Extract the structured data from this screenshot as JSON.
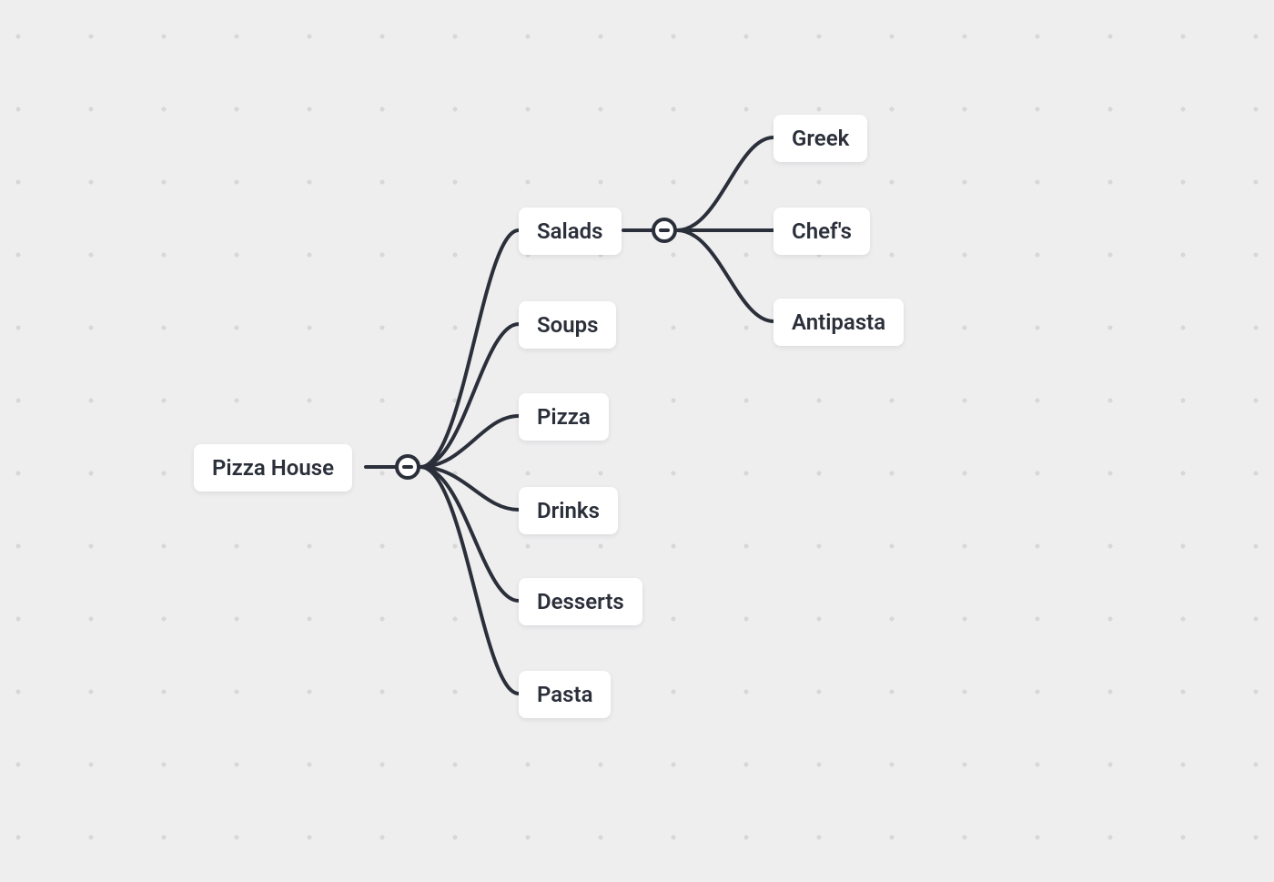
{
  "root": {
    "label": "Pizza House",
    "children": [
      {
        "label": "Salads",
        "expanded": true,
        "children": [
          {
            "label": "Greek"
          },
          {
            "label": "Chef's"
          },
          {
            "label": "Antipasta"
          }
        ]
      },
      {
        "label": "Soups"
      },
      {
        "label": "Pizza"
      },
      {
        "label": "Drinks"
      },
      {
        "label": "Desserts"
      },
      {
        "label": "Pasta"
      }
    ]
  }
}
